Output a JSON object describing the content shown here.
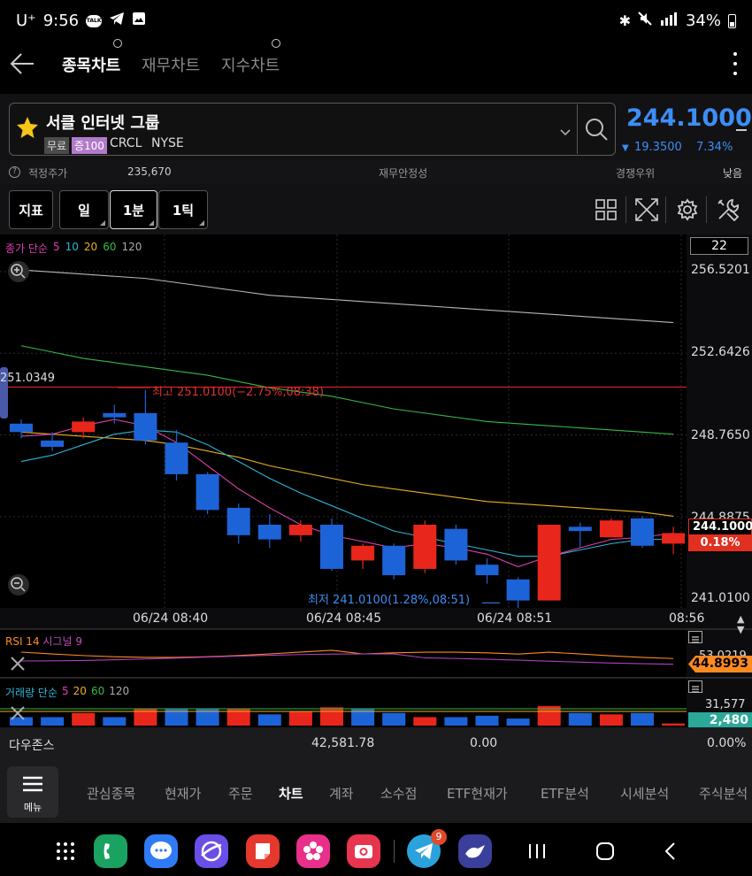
{
  "statusbar": {
    "carrier": "U⁺",
    "time": "9:56",
    "talk": "TALK",
    "battery": "34%"
  },
  "header": {
    "tabs": [
      "종목차트",
      "재무차트",
      "지수차트"
    ]
  },
  "stock": {
    "name": "서클 인터넷 그룹",
    "badge_free": "무료",
    "badge_margin": "증100",
    "ticker": "CRCL",
    "exchange": "NYSE",
    "price": "244.1000",
    "change_arrow": "▼",
    "change": "19.3500",
    "change_pct": "7.34%"
  },
  "info": {
    "fair_label": "적정주가",
    "fair_value": "235,670",
    "fin_label": "재무안정성",
    "comp_label": "경쟁우위",
    "comp_value": "낮음"
  },
  "toolbar": {
    "indicator": "지표",
    "day": "일",
    "min": "1분",
    "tick": "1틱"
  },
  "chart": {
    "legend": {
      "name": "종가 단순",
      "periods": [
        "5",
        "10",
        "20",
        "60",
        "120"
      ]
    },
    "axis_top_box": "22",
    "y_labels": [
      "256.5201",
      "252.6426",
      "248.7650",
      "244.8875",
      "241.0100"
    ],
    "price_tag": "244.1000",
    "pct_tag": "0.18%",
    "left_label": "251.0349",
    "high_label": "최고 251.0100(−2.75%,08:38)",
    "low_label": "최저 241.0100(1.28%,08:51)",
    "time_labels": [
      "06/24 08:40",
      "06/24 08:45",
      "06/24 08:51",
      "08:56"
    ],
    "rsi": {
      "label": "RSI 14",
      "signal": "시그널 9",
      "upper": "53.0219",
      "value": "44.8993"
    },
    "volume": {
      "label": "거래량 단순",
      "periods": [
        "5",
        "20",
        "60",
        "120"
      ],
      "upper": "31,577",
      "value": "2,480"
    }
  },
  "chart_data": {
    "type": "candlestick",
    "ylim": [
      241.01,
      256.5201
    ],
    "candles": [
      {
        "o": 249.3,
        "c": 248.9,
        "h": 249.5,
        "l": 248.6,
        "up": false
      },
      {
        "o": 248.5,
        "c": 248.2,
        "h": 248.9,
        "l": 248.0,
        "up": false
      },
      {
        "o": 248.9,
        "c": 249.4,
        "h": 249.6,
        "l": 248.6,
        "up": true
      },
      {
        "o": 249.8,
        "c": 249.6,
        "h": 250.2,
        "l": 249.3,
        "up": false
      },
      {
        "o": 249.8,
        "c": 248.5,
        "h": 250.9,
        "l": 248.3,
        "up": false
      },
      {
        "o": 248.4,
        "c": 246.9,
        "h": 249.0,
        "l": 246.6,
        "up": false
      },
      {
        "o": 246.9,
        "c": 245.2,
        "h": 247.0,
        "l": 245.0,
        "up": false
      },
      {
        "o": 245.3,
        "c": 244.0,
        "h": 245.5,
        "l": 243.6,
        "up": false
      },
      {
        "o": 244.5,
        "c": 243.8,
        "h": 245.0,
        "l": 243.4,
        "up": false
      },
      {
        "o": 244.5,
        "c": 244.0,
        "h": 244.7,
        "l": 243.7,
        "up": true
      },
      {
        "o": 244.5,
        "c": 242.4,
        "h": 244.8,
        "l": 242.3,
        "up": false
      },
      {
        "o": 243.5,
        "c": 242.8,
        "h": 243.6,
        "l": 242.4,
        "up": true
      },
      {
        "o": 243.5,
        "c": 242.1,
        "h": 243.6,
        "l": 241.9,
        "up": false
      },
      {
        "o": 242.4,
        "c": 244.5,
        "h": 244.7,
        "l": 242.2,
        "up": true
      },
      {
        "o": 244.3,
        "c": 242.8,
        "h": 244.5,
        "l": 242.6,
        "up": false
      },
      {
        "o": 242.6,
        "c": 242.1,
        "h": 242.9,
        "l": 241.7,
        "up": false
      },
      {
        "o": 241.9,
        "c": 240.9,
        "h": 242.0,
        "l": 240.4,
        "up": false
      },
      {
        "o": 240.9,
        "c": 244.5,
        "h": 244.5,
        "l": 240.9,
        "up": true
      },
      {
        "o": 244.4,
        "c": 244.2,
        "h": 244.6,
        "l": 243.4,
        "up": false
      },
      {
        "o": 243.9,
        "c": 244.7,
        "h": 244.8,
        "l": 243.9,
        "up": true
      },
      {
        "o": 244.8,
        "c": 243.5,
        "h": 244.9,
        "l": 243.4,
        "up": false
      },
      {
        "o": 243.6,
        "c": 244.1,
        "h": 244.4,
        "l": 243.1,
        "up": true
      }
    ],
    "ma120": [
      256.6,
      256.5,
      256.4,
      256.3,
      256.2,
      256.0,
      255.8,
      255.6,
      255.4,
      255.3,
      255.2,
      255.1,
      255.0,
      254.9,
      254.8,
      254.7,
      254.6,
      254.5,
      254.4,
      254.3,
      254.2,
      254.1
    ],
    "ma60": [
      253.0,
      252.7,
      252.4,
      252.2,
      252.0,
      251.8,
      251.6,
      251.3,
      251.0,
      250.8,
      250.6,
      250.3,
      250.0,
      249.8,
      249.6,
      249.4,
      249.3,
      249.2,
      249.1,
      249.0,
      248.9,
      248.8
    ],
    "ma20": [
      248.9,
      248.8,
      248.7,
      248.6,
      248.5,
      248.3,
      248.0,
      247.7,
      247.3,
      247.0,
      246.7,
      246.4,
      246.2,
      246.0,
      245.8,
      245.6,
      245.5,
      245.4,
      245.3,
      245.2,
      245.1,
      244.9
    ],
    "ma10": [
      247.5,
      247.8,
      248.3,
      248.8,
      249.0,
      248.9,
      248.3,
      247.5,
      246.7,
      246.0,
      245.4,
      244.8,
      244.2,
      243.9,
      243.6,
      243.3,
      243.0,
      243.0,
      243.3,
      243.6,
      243.8,
      243.8
    ],
    "ma5": [
      248.7,
      248.8,
      249.2,
      249.5,
      249.2,
      248.4,
      247.3,
      246.2,
      245.3,
      244.5,
      244.0,
      243.7,
      243.4,
      243.6,
      243.4,
      243.1,
      242.5,
      243.0,
      243.4,
      243.8,
      243.9,
      244.1
    ],
    "volume": [
      6000,
      6000,
      9000,
      6000,
      12000,
      12000,
      12000,
      12000,
      8000,
      10000,
      13000,
      12000,
      9000,
      6000,
      6000,
      7000,
      5000,
      14000,
      9000,
      8000,
      9000,
      1500
    ],
    "volume_up": [
      false,
      false,
      true,
      false,
      true,
      false,
      false,
      true,
      false,
      true,
      true,
      false,
      false,
      true,
      false,
      false,
      false,
      true,
      false,
      true,
      false,
      true
    ]
  },
  "footer": {
    "index_name": "다우존스",
    "index_value": "42,581.78",
    "index_change": "0.00",
    "index_pct": "0.00%"
  },
  "bottomnav": {
    "menu": "메뉴",
    "items": [
      "관심종목",
      "현재가",
      "주문",
      "차트",
      "계좌",
      "소수점",
      "ETF현재가",
      "ETF분석",
      "시세분석",
      "주식분석"
    ]
  },
  "dock": {
    "badge": "9"
  }
}
